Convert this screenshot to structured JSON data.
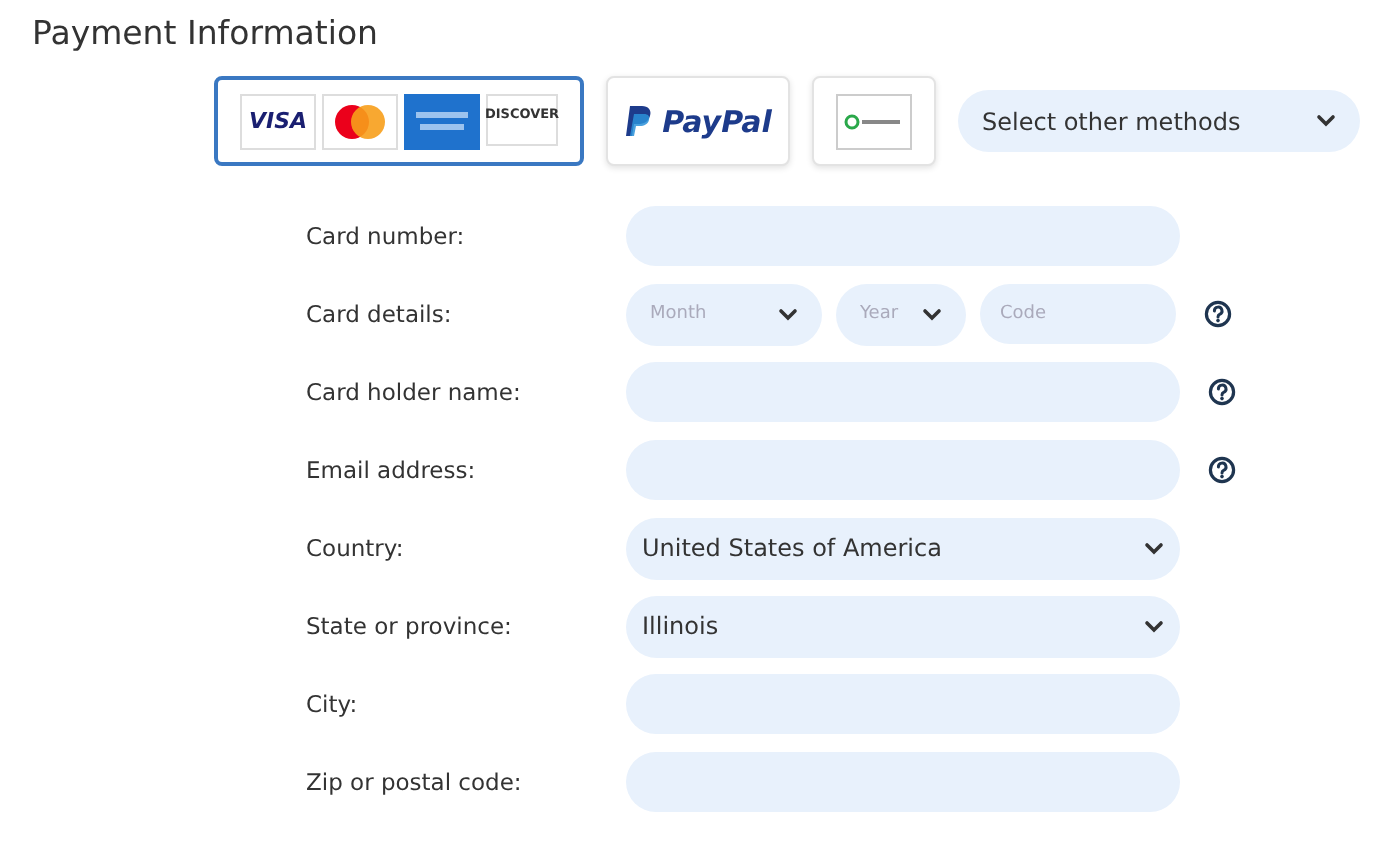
{
  "title": "Payment Information",
  "methods": [
    {
      "kind": "cards",
      "selected": true,
      "logos": [
        {
          "kind": "visa",
          "text": "VISA"
        },
        {
          "kind": "mastercard"
        },
        {
          "kind": "amex"
        },
        {
          "kind": "discover",
          "text": "DISCOVER"
        }
      ]
    },
    {
      "kind": "paypal",
      "selected": false,
      "text": "PayPal"
    },
    {
      "kind": "other",
      "selected": false
    }
  ],
  "other_methods": {
    "value": "Select other methods"
  },
  "fields": [
    {
      "kind": "text",
      "label": "Card number:",
      "help": false
    },
    {
      "kind": "card_details",
      "label": "Card details:",
      "help": true,
      "parts": [
        {
          "kind": "select",
          "placeholder": "Month"
        },
        {
          "kind": "select",
          "placeholder": "Year"
        },
        {
          "kind": "text",
          "placeholder": "Code"
        }
      ]
    },
    {
      "kind": "text",
      "label": "Card holder name:",
      "help": true
    },
    {
      "kind": "text",
      "label": "Email address:",
      "help": true
    },
    {
      "kind": "select",
      "label": "Country:",
      "value": "United States of America",
      "help": false
    },
    {
      "kind": "select",
      "label": "State or province:",
      "value": "Illinois",
      "help": false
    },
    {
      "kind": "text",
      "label": "City:",
      "help": false
    },
    {
      "kind": "text",
      "label": "Zip or postal code:",
      "help": false
    }
  ]
}
